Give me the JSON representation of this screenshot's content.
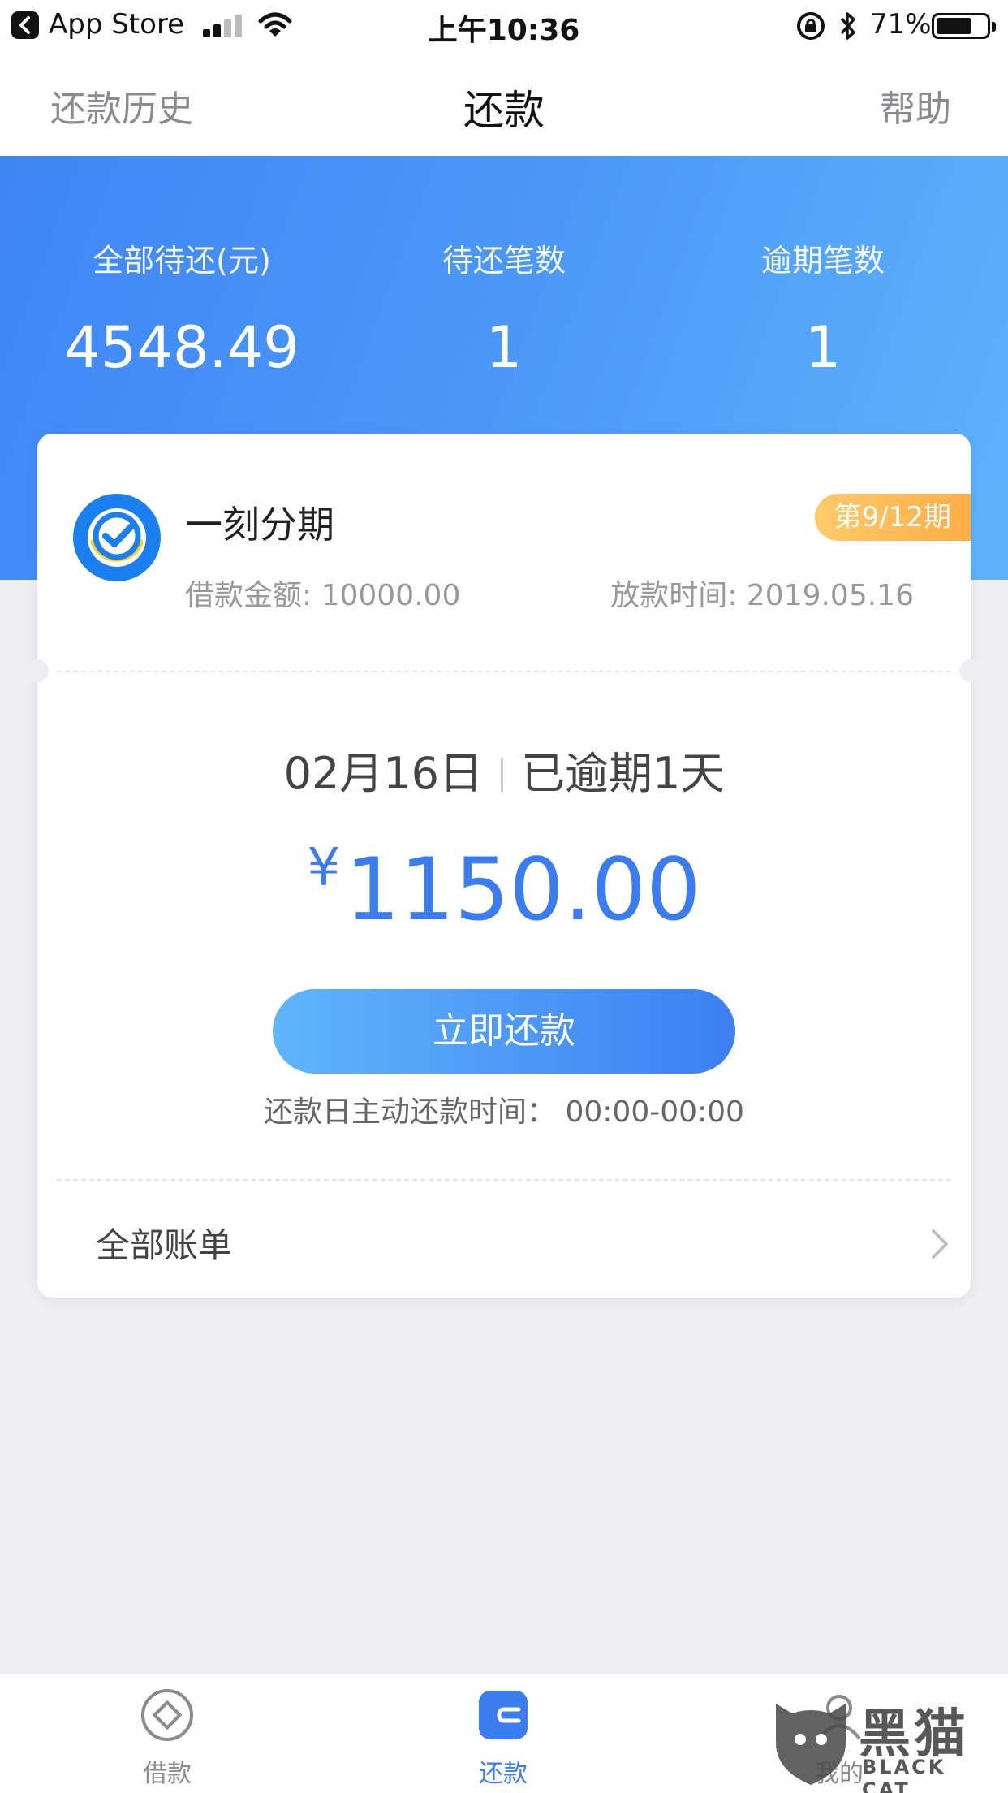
{
  "status_bar": {
    "back_app": "App Store",
    "time": "上午10:36",
    "battery": "71%",
    "battery_level": 0.71,
    "icons": [
      "signal-icon",
      "wifi-icon",
      "rotation-lock-icon",
      "bluetooth-icon",
      "battery-icon"
    ]
  },
  "nav": {
    "left": "还款历史",
    "title": "还款",
    "right": "帮助"
  },
  "summary": {
    "total_label": "全部待还(元)",
    "total_value": "4548.49",
    "pending_label": "待还笔数",
    "pending_value": "1",
    "overdue_label": "逾期笔数",
    "overdue_value": "1"
  },
  "loan": {
    "product_name": "一刻分期",
    "period_badge": "第9/12期",
    "loan_amount": "借款金额: 10000.00",
    "disburse_date": "放款时间: 2019.05.16",
    "due_date": "02月16日",
    "due_status": "已逾期1天",
    "currency": "¥",
    "amount": "1150.00",
    "pay_button": "立即还款",
    "pay_hint": "还款日主动还款时间：  00:00-00:00",
    "all_bills": "全部账单"
  },
  "tabs": [
    {
      "label": "借款",
      "icon": "loan-icon",
      "active": false
    },
    {
      "label": "还款",
      "icon": "repay-icon",
      "active": true
    },
    {
      "label": "我的",
      "icon": "profile-icon",
      "active": false
    }
  ],
  "watermark": {
    "text": "黑猫",
    "sub": "BLACK CAT"
  },
  "colors": {
    "accent": "#3b7df0",
    "banner_start": "#3f86f5",
    "banner_end": "#5fb3fb",
    "badge": "#ffad45",
    "tab_inactive": "#8a8a8f"
  }
}
